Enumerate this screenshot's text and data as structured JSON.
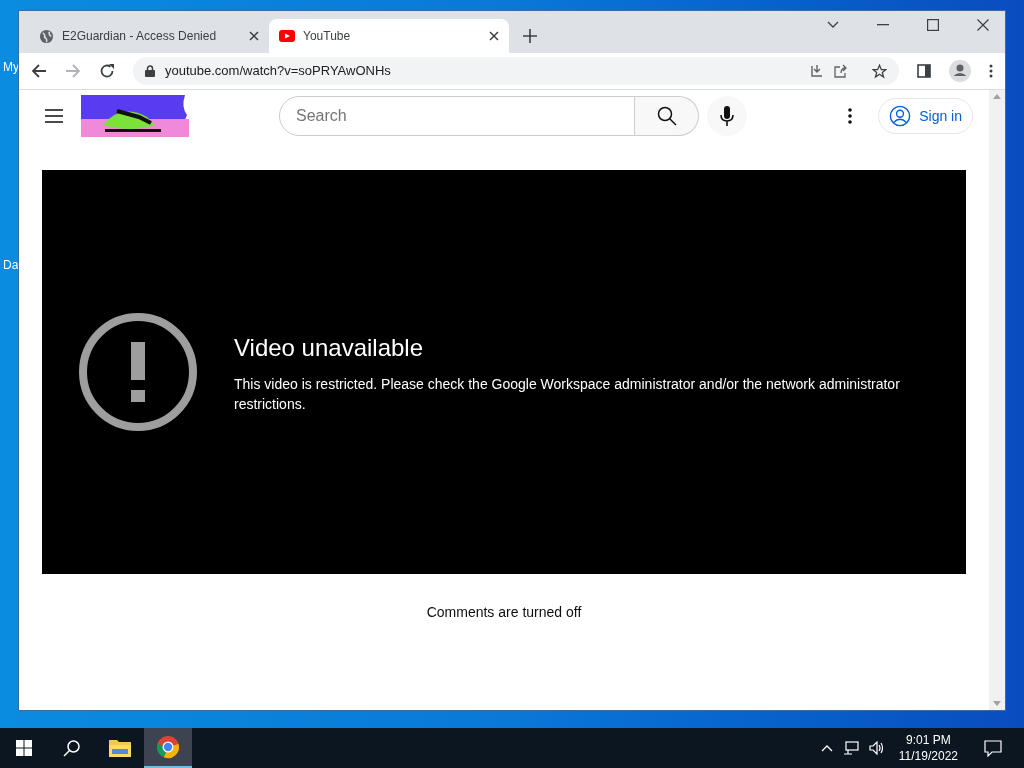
{
  "desktop": {
    "icon_labels": [
      "My",
      "Da"
    ]
  },
  "browser": {
    "tabs": [
      {
        "title": "E2Guardian - Access Denied",
        "kind": "globe",
        "selected": false
      },
      {
        "title": "YouTube",
        "kind": "youtube",
        "selected": true
      }
    ],
    "address": "youtube.com/watch?v=soPRYAwONHs"
  },
  "page": {
    "search": {
      "placeholder": "Search"
    },
    "sign_in": "Sign in",
    "video": {
      "title": "Video unavailable",
      "message": "This video is restricted. Please check the Google Workspace administrator and/or the network administrator restrictions."
    },
    "comments_note": "Comments are turned off"
  },
  "taskbar": {
    "apps": [
      {
        "kind": "folder",
        "selected": false
      },
      {
        "kind": "chrome",
        "selected": true
      }
    ],
    "time": "9:01 PM",
    "date": "11/19/2022"
  }
}
